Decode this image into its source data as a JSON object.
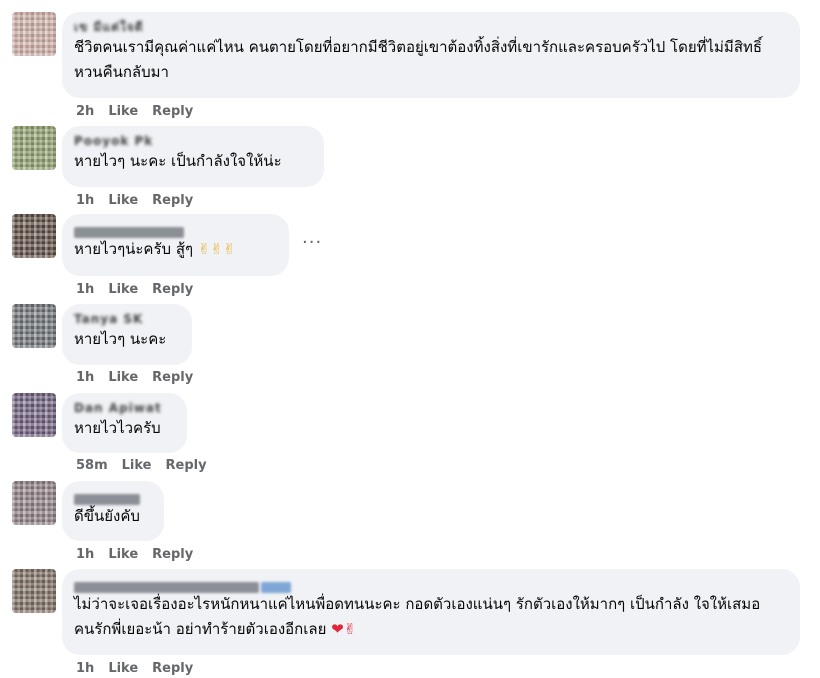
{
  "comments": [
    {
      "author": "เข มีแต่ใจดี",
      "text": "ชีวิตคนเรามีคุณค่าแค่ไหน คนตายโดยที่อยากมีชีวิตอยู่เขาต้องทิ้งสิ่งที่เขารักและครอบครัวไป โดยที่ไม่มีสิทธิ์หวนคืนกลับมา",
      "time": "2h",
      "like": "Like",
      "reply": "Reply",
      "avatar_color": "#c9a9a0"
    },
    {
      "author": "Pooyok Pk",
      "text": "หายไวๆ นะคะ เป็นกำลังใจให้น่ะ",
      "time": "1h",
      "like": "Like",
      "reply": "Reply",
      "avatar_color": "#8a9a6a"
    },
    {
      "author": "",
      "text": "หายไวๆน่ะครับ สู้ๆ",
      "emoji": "✌✌✌",
      "time": "1h",
      "like": "Like",
      "reply": "Reply",
      "more": "···",
      "avatar_color": "#5a4a40"
    },
    {
      "author": "Tanya SK",
      "text": "หายไวๆ นะคะ",
      "time": "1h",
      "like": "Like",
      "reply": "Reply",
      "avatar_color": "#6a6e72"
    },
    {
      "author": "Dan Apiwat",
      "text": "หายไวไวครับ",
      "time": "58m",
      "like": "Like",
      "reply": "Reply",
      "avatar_color": "#6a5a78"
    },
    {
      "author": "",
      "text": "ดีขึ้นยังคับ",
      "time": "1h",
      "like": "Like",
      "reply": "Reply",
      "avatar_color": "#8a7a80"
    },
    {
      "author": "",
      "text": "ไม่ว่าจะเจอเรื่องอะไรหนักหนาแค่ไหนพื่อดทนนะคะ กอดตัวเองแน่นๆ รักตัวเองให้มากๆ เป็นกำลัง ใจให้เสมอ คนรักพี่เยอะน้า อย่าทำร้ายตัวเองอีกเลย",
      "emoji": "❤✌",
      "time": "1h",
      "like": "Like",
      "reply": "Reply",
      "avatar_color": "#7a6a60"
    }
  ]
}
